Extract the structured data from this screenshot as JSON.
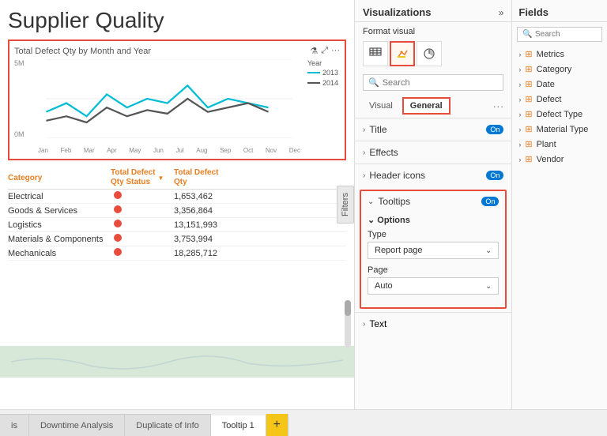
{
  "page": {
    "title": "Supplier Quality"
  },
  "chart": {
    "title": "Total Defect Qty by Month and Year",
    "y_max": "5M",
    "y_min": "0M",
    "months": [
      "Jan",
      "Feb",
      "Mar",
      "Apr",
      "May",
      "Jun",
      "Jul",
      "Aug",
      "Sep",
      "Oct",
      "Nov",
      "Dec"
    ],
    "legend": {
      "label": "Year",
      "item1": "2013",
      "item2": "2014"
    }
  },
  "table": {
    "col1": "Category",
    "col2": "Total Defect\nQty Status",
    "col3": "Total Defect\nQty",
    "rows": [
      {
        "category": "Electrical",
        "qty": "1,653,462"
      },
      {
        "category": "Goods & Services",
        "qty": "3,356,864"
      },
      {
        "category": "Logistics",
        "qty": "13,151,993"
      },
      {
        "category": "Materials & Components",
        "qty": "3,753,994"
      },
      {
        "category": "Mechanicals",
        "qty": "18,285,712"
      }
    ]
  },
  "visualizations": {
    "title": "Visualizations",
    "format_visual": "Format visual",
    "search_placeholder": "Search",
    "tab_visual": "Visual",
    "tab_general": "General",
    "section_title": {
      "label": "Title",
      "status": "On"
    },
    "section_effects": {
      "label": "Effects"
    },
    "section_header_icons": {
      "label": "Header icons",
      "status": "On"
    },
    "section_tooltips": {
      "label": "Tooltips",
      "status": "On",
      "options_label": "Options",
      "type_label": "Type",
      "type_value": "Report page",
      "page_label": "Page",
      "page_value": "Auto"
    },
    "section_text": {
      "label": "Text"
    }
  },
  "fields": {
    "title": "Fields",
    "search_placeholder": "Search",
    "items": [
      {
        "name": "Metrics"
      },
      {
        "name": "Category"
      },
      {
        "name": "Date"
      },
      {
        "name": "Defect"
      },
      {
        "name": "Defect Type"
      },
      {
        "name": "Material Type"
      },
      {
        "name": "Plant"
      },
      {
        "name": "Vendor"
      }
    ]
  },
  "tabs": [
    {
      "label": "is",
      "active": false
    },
    {
      "label": "Downtime Analysis",
      "active": false
    },
    {
      "label": "Duplicate of Info",
      "active": false
    },
    {
      "label": "Tooltip 1",
      "active": true
    }
  ],
  "tab_add": "+",
  "filters_label": "Filters"
}
